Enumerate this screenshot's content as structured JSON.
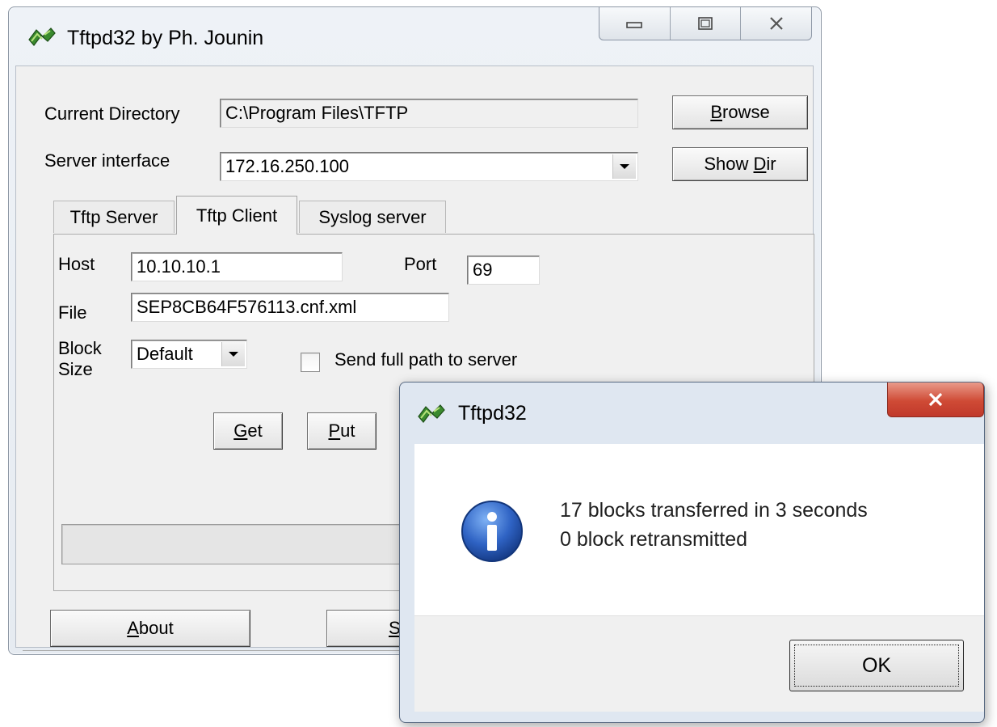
{
  "main_window": {
    "title": "Tftpd32 by Ph. Jounin",
    "current_directory": {
      "label": "Current Directory",
      "value": "C:\\Program Files\\TFTP"
    },
    "server_interface": {
      "label": "Server interface",
      "value": "172.16.250.100"
    },
    "buttons": {
      "browse": {
        "ul": "B",
        "rest": "rowse"
      },
      "show_dir": {
        "pre": "Show ",
        "ul": "D",
        "rest": "ir"
      }
    },
    "tabs": [
      "Tftp Server",
      "Tftp Client",
      "Syslog server"
    ],
    "active_tab": "Tftp Client",
    "client": {
      "host_label": "Host",
      "host_value": "10.10.10.1",
      "port_label": "Port",
      "port_value": "69",
      "file_label": "File",
      "file_value": "SEP8CB64F576113.cnf.xml",
      "block_label_1": "Block",
      "block_label_2": "Size",
      "block_value": "Default",
      "full_path_label": "Send full path to server",
      "full_path_checked": false,
      "get": {
        "ul": "G",
        "rest": "et"
      },
      "put": {
        "ul": "P",
        "rest": "ut"
      }
    },
    "bottom": {
      "about": {
        "ul": "A",
        "rest": "bout"
      },
      "settings_partial": "S"
    }
  },
  "dialog": {
    "title": "Tftpd32",
    "message_line1": "17 blocks transferred in 3 seconds",
    "message_line2": "0 block retransmitted",
    "ok_label": "OK",
    "icon": "info-icon"
  },
  "colors": {
    "close_red": "#c0392b",
    "info_blue": "#2f63c4"
  }
}
